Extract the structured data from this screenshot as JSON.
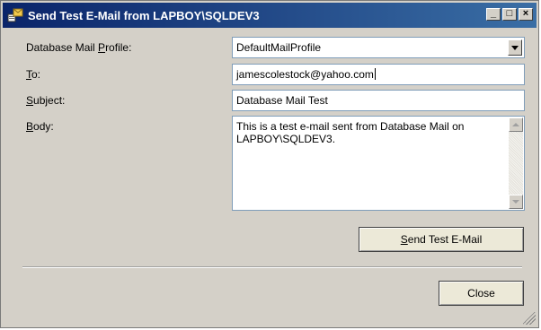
{
  "window": {
    "title": "Send Test E-Mail from LAPBOY\\SQLDEV3",
    "min_glyph": "_",
    "max_glyph": "□",
    "close_glyph": "×"
  },
  "form": {
    "profile_label_pre": "Database Mail ",
    "profile_label_u": "P",
    "profile_label_post": "rofile:",
    "profile_value": "DefaultMailProfile",
    "to_label_u": "T",
    "to_label_post": "o:",
    "to_value": "jamescolestock@yahoo.com",
    "subject_label_u": "S",
    "subject_label_post": "ubject:",
    "subject_value": "Database Mail Test",
    "body_label_u": "B",
    "body_label_post": "ody:",
    "body_value": "This is a test e-mail sent from Database Mail on LAPBOY\\SQLDEV3."
  },
  "buttons": {
    "send_u": "S",
    "send_post": "end Test E-Mail",
    "close": "Close"
  },
  "icons": {
    "title_icon": "mail-server-icon",
    "grip": "resize-grip-icon"
  }
}
